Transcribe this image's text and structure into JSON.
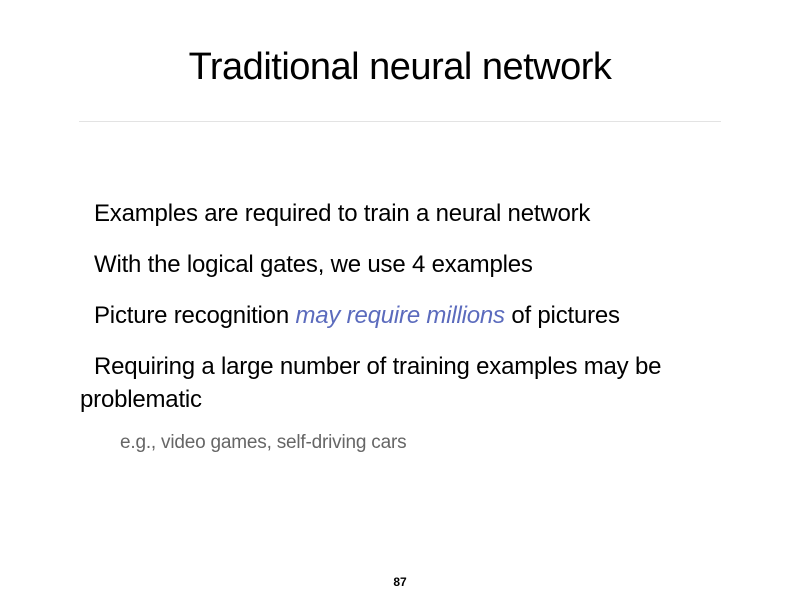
{
  "slide": {
    "title": "Traditional neural network",
    "bullets": [
      {
        "text": "Examples are required to train a neural network"
      },
      {
        "text": "With the logical gates, we use 4 examples"
      },
      {
        "before": "Picture recognition ",
        "emphasis": "may require millions",
        "after": " of pictures"
      },
      {
        "text": "Requiring a large number of training examples may be problematic"
      }
    ],
    "sub_bullet": "e.g., video games, self-driving cars",
    "page_number": "87",
    "colors": {
      "emphasis": "#5b6bbd",
      "sub_text": "#666666",
      "divider": "#e3e3e3"
    }
  }
}
